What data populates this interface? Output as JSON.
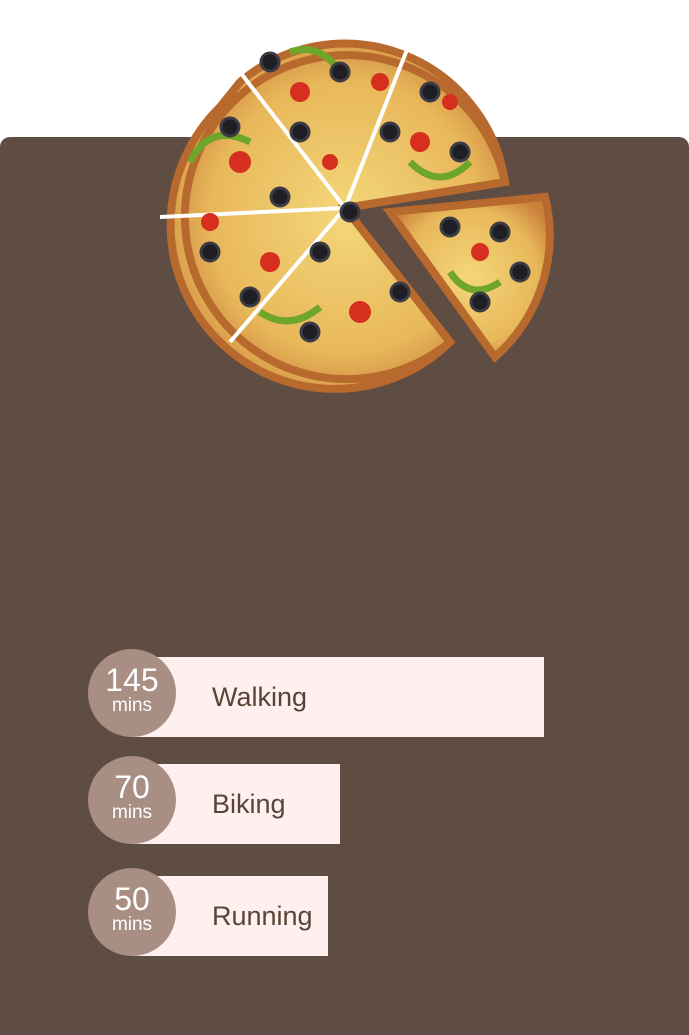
{
  "activities": [
    {
      "value": "145",
      "unit": "mins",
      "name": "Walking"
    },
    {
      "value": "70",
      "unit": "mins",
      "name": "Biking"
    },
    {
      "value": "50",
      "unit": "mins",
      "name": "Running"
    }
  ],
  "colors": {
    "card": "#5f4c42",
    "bar": "#fdf0ef",
    "badge": "#a88e83",
    "label": "#5b4337"
  }
}
